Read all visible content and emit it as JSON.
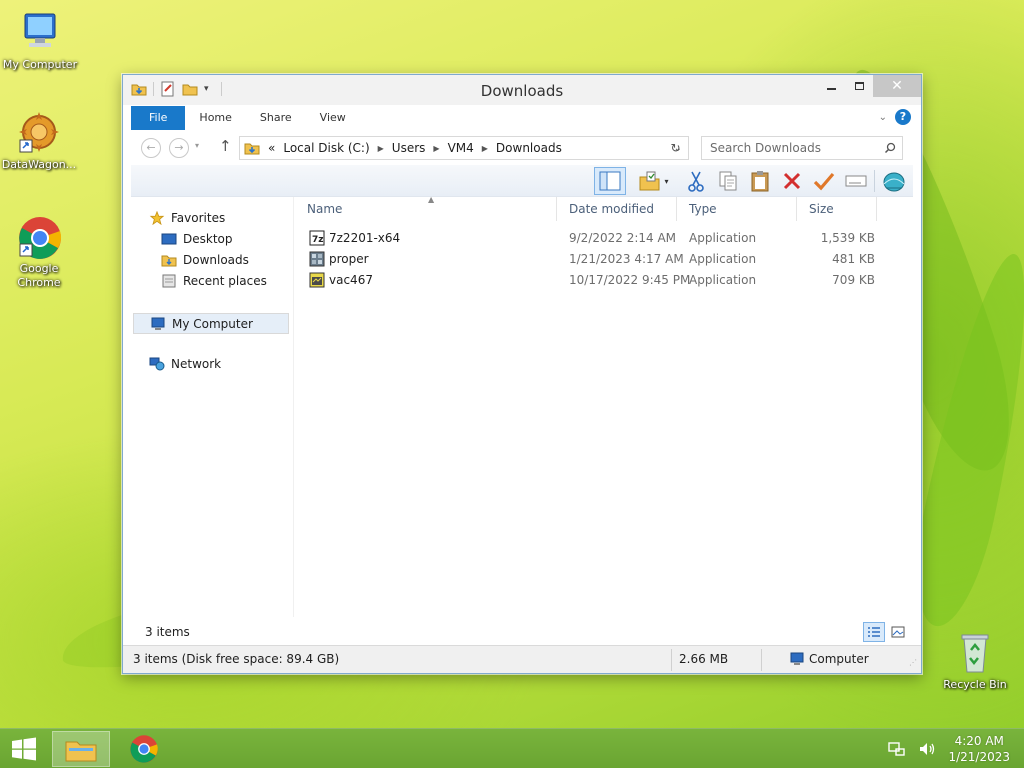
{
  "desktop": {
    "icons": [
      {
        "label": "My Computer"
      },
      {
        "label": "DataWagon..."
      },
      {
        "label": "Google Chrome"
      },
      {
        "label": "Recycle Bin"
      }
    ]
  },
  "window": {
    "title": "Downloads",
    "close_glyph": "✕",
    "ribbon_tabs": [
      "File",
      "Home",
      "Share",
      "View"
    ],
    "help_glyph": "?",
    "address": {
      "prefix": "«",
      "crumbs": [
        "Local Disk (C:)",
        "Users",
        "VM4",
        "Downloads"
      ]
    },
    "search_placeholder": "Search Downloads",
    "nav": {
      "favorites": "Favorites",
      "desktop": "Desktop",
      "downloads": "Downloads",
      "recent": "Recent places",
      "my_computer": "My Computer",
      "network": "Network"
    },
    "columns": [
      "Name",
      "Date modified",
      "Type",
      "Size"
    ],
    "files": [
      {
        "name": "7z2201-x64",
        "date": "9/2/2022 2:14 AM",
        "type": "Application",
        "size": "1,539 KB"
      },
      {
        "name": "proper",
        "date": "1/21/2023 4:17 AM",
        "type": "Application",
        "size": "481 KB"
      },
      {
        "name": "vac467",
        "date": "10/17/2022 9:45 PM",
        "type": "Application",
        "size": "709 KB"
      }
    ],
    "item_count": "3 items",
    "status": {
      "left": "3 items (Disk free space: 89.4 GB)",
      "size": "2.66 MB",
      "location": "Computer"
    }
  },
  "taskbar": {
    "time": "4:20 AM",
    "date": "1/21/2023"
  },
  "colors": {
    "accent": "#1979ca",
    "taskbar": "#6aa532"
  }
}
